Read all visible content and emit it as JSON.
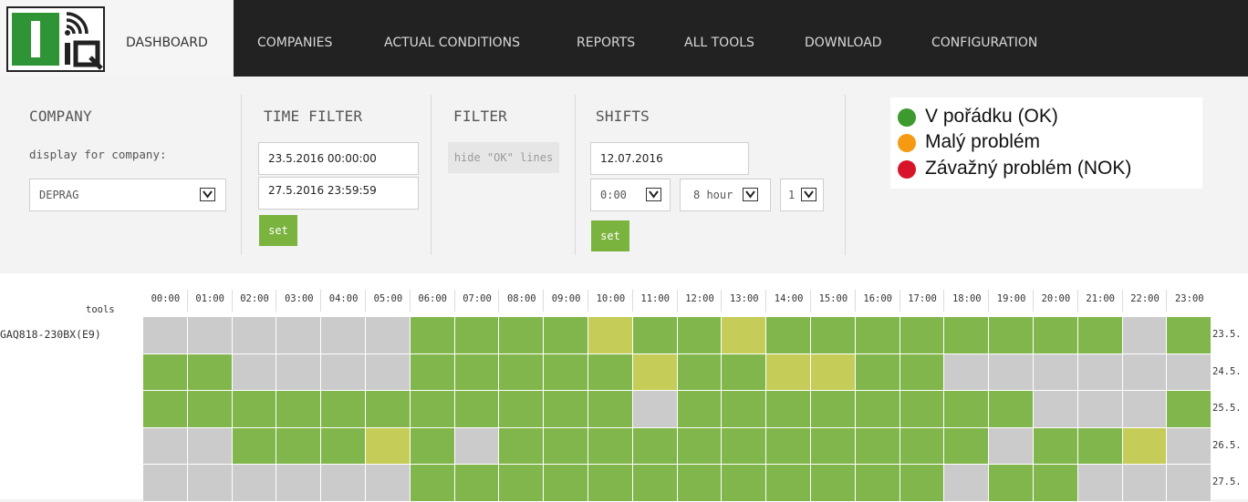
{
  "nav": {
    "items": [
      {
        "label": "DASHBOARD",
        "active": true
      },
      {
        "label": "COMPANIES",
        "active": false
      },
      {
        "label": "ACTUAL CONDITIONS",
        "active": false
      },
      {
        "label": "REPORTS",
        "active": false
      },
      {
        "label": "ALL TOOLS",
        "active": false
      },
      {
        "label": "DOWNLOAD",
        "active": false
      },
      {
        "label": "CONFIGURATION",
        "active": false
      }
    ]
  },
  "company": {
    "title": "COMPANY",
    "label": "display for company:",
    "selected": "DEPRAG"
  },
  "time_filter": {
    "title": "TIME FILTER",
    "from": "23.5.2016 00:00:00",
    "to": "27.5.2016 23:59:59",
    "set_label": "set"
  },
  "filter": {
    "title": "FILTER",
    "hide_ok_label": "hide \"OK\" lines"
  },
  "shifts": {
    "title": "SHIFTS",
    "date": "12.07.2016",
    "start": "0:00",
    "length": "8 hour",
    "count": "1",
    "set_label": "set"
  },
  "legend": {
    "items": [
      {
        "label": "V pořádku (OK)",
        "color": "#3c9a2e"
      },
      {
        "label": "Malý problém",
        "color": "#f59a12"
      },
      {
        "label": "Závažný problém (NOK)",
        "color": "#d8142a"
      }
    ]
  },
  "grid": {
    "tools_label": "tools",
    "tool_name": "GAQ818-230BX(E9)",
    "status_colors": {
      "none": "#cbcbcb",
      "ok": "#80b64b",
      "minor": "#c5cc58"
    },
    "hours": [
      "00:00",
      "01:00",
      "02:00",
      "03:00",
      "04:00",
      "05:00",
      "06:00",
      "07:00",
      "08:00",
      "09:00",
      "10:00",
      "11:00",
      "12:00",
      "13:00",
      "14:00",
      "15:00",
      "16:00",
      "17:00",
      "18:00",
      "19:00",
      "20:00",
      "21:00",
      "22:00",
      "23:00"
    ],
    "rows": [
      {
        "date": "23.5.",
        "cells": [
          0,
          0,
          0,
          0,
          0,
          0,
          1,
          1,
          1,
          1,
          2,
          1,
          1,
          2,
          1,
          1,
          1,
          1,
          1,
          1,
          1,
          1,
          0,
          1
        ]
      },
      {
        "date": "24.5.",
        "cells": [
          1,
          1,
          0,
          0,
          0,
          0,
          1,
          1,
          1,
          1,
          1,
          2,
          1,
          1,
          2,
          2,
          1,
          1,
          0,
          0,
          0,
          0,
          0,
          0
        ]
      },
      {
        "date": "25.5.",
        "cells": [
          1,
          1,
          1,
          1,
          1,
          1,
          1,
          1,
          1,
          1,
          1,
          0,
          1,
          1,
          1,
          1,
          1,
          1,
          1,
          1,
          0,
          0,
          0,
          1
        ]
      },
      {
        "date": "26.5.",
        "cells": [
          0,
          0,
          1,
          1,
          1,
          2,
          1,
          0,
          1,
          1,
          1,
          1,
          1,
          1,
          1,
          1,
          1,
          1,
          1,
          0,
          1,
          1,
          2,
          0
        ]
      },
      {
        "date": "27.5.",
        "cells": [
          0,
          0,
          0,
          0,
          0,
          0,
          1,
          1,
          1,
          1,
          1,
          1,
          1,
          1,
          1,
          1,
          1,
          1,
          0,
          1,
          1,
          0,
          0,
          0
        ]
      }
    ]
  }
}
